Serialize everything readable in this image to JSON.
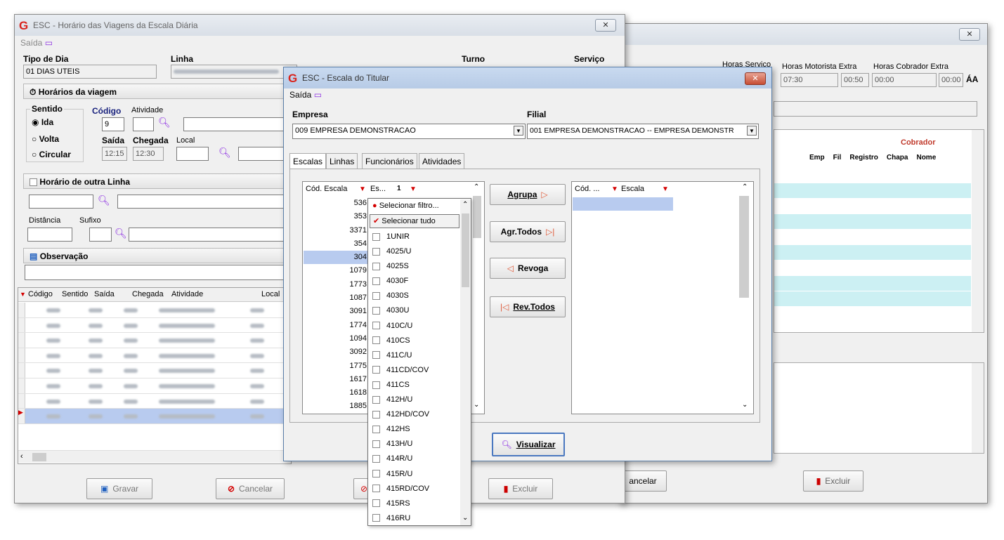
{
  "bg_window": {
    "title": "",
    "tail": {
      "col1_text": "Horas Servico",
      "col2_label": "Horas Motorista Extra",
      "col2_val1": "07:30",
      "col2_val2": "00:50",
      "col3_label": "Horas Cobrador Extra",
      "col3_val1": "00:00",
      "col3_val2": "00:00",
      "aa": "ÁA",
      "cobrador": "Cobrador",
      "cols": [
        "Emp",
        "Fil",
        "Registro",
        "Chapa",
        "Nome"
      ],
      "cancelar": "ancelar",
      "excluir": "Excluir"
    }
  },
  "main_window": {
    "title": "ESC - Horário das Viagens da Escala Diária",
    "menu_saida": "Saída",
    "tipo_dia_label": "Tipo de Dia",
    "tipo_dia_value": "01 DIAS UTEIS",
    "linha_label": "Linha",
    "turno_label": "Turno",
    "servico_label": "Serviço",
    "horarios_header": "Horários da viagem",
    "sentido_label": "Sentido",
    "ida": "Ida",
    "volta": "Volta",
    "circular": "Circular",
    "codigo_label": "Código",
    "codigo_value": "9",
    "atividade_label": "Atividade",
    "saida_label": "Saída",
    "saida_value": "12:15",
    "chegada_label": "Chegada",
    "chegada_value": "12:30",
    "local_label": "Local",
    "outra_linha_header": "Horário de outra Linha",
    "distancia_label": "Distância",
    "sufixo_label": "Sufixo",
    "observacao_header": "Observação",
    "grid_cols": [
      "Código",
      "Sentido",
      "Saída",
      "Chegada",
      "Atividade",
      "Local"
    ],
    "gravar": "Gravar",
    "cancelar": "Cancelar",
    "excluir": "Excluir"
  },
  "dialog": {
    "title": "ESC - Escala do Titular",
    "menu_saida": "Saída",
    "empresa_label": "Empresa",
    "empresa_value": "009 EMPRESA DEMONSTRACAO",
    "filial_label": "Filial",
    "filial_value": "001 EMPRESA DEMONSTRACAO -- EMPRESA DEMONSTR",
    "tabs": [
      "Escalas",
      "Linhas",
      "Funcionários",
      "Atividades"
    ],
    "left_cols": {
      "cod": "Cód. Escala",
      "es": "Es...",
      "num": "1"
    },
    "left_rows": [
      "536",
      "353",
      "3371",
      "354",
      "304",
      "1079",
      "1773",
      "1087",
      "3091",
      "1774",
      "1094",
      "3092",
      "1775",
      "1617",
      "1618",
      "1885"
    ],
    "right_cols": {
      "cod": "Cód. ...",
      "escala": "Escala"
    },
    "agrupa": "Agrupa",
    "agr_todos": "Agr.Todos",
    "revoga": "Revoga",
    "rev_todos": "Rev.Todos",
    "visualizar": "Visualizar"
  },
  "filter_dropdown": {
    "selecionar_filtro": "Selecionar filtro...",
    "selecionar_tudo": "Selecionar tudo",
    "items": [
      "1UNIR",
      "4025/U",
      "4025S",
      "4030F",
      "4030S",
      "4030U",
      "410C/U",
      "410CS",
      "411C/U",
      "411CD/COV",
      "411CS",
      "412H/U",
      "412HD/COV",
      "412HS",
      "413H/U",
      "414R/U",
      "415R/U",
      "415RD/COV",
      "415RS",
      "416RU"
    ]
  }
}
